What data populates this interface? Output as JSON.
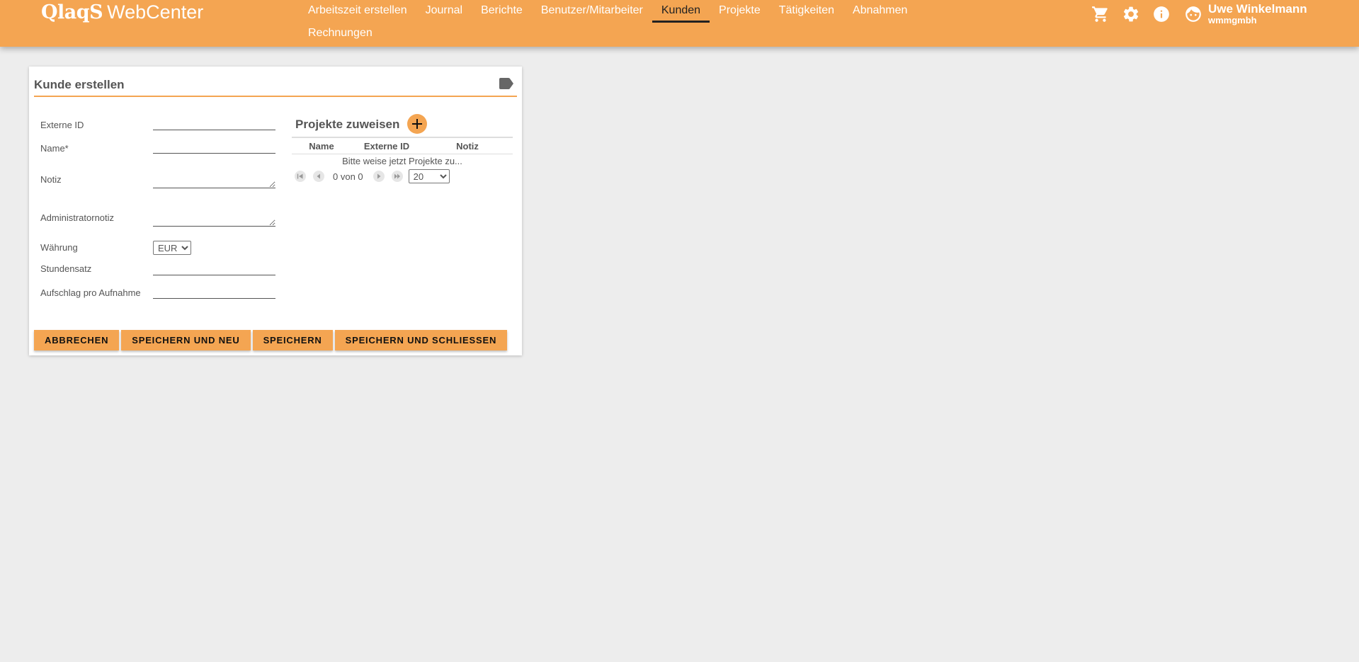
{
  "brand": {
    "logo": "QlaqS",
    "product": "WebCenter"
  },
  "nav": {
    "items": [
      {
        "label": "Arbeitszeit erstellen"
      },
      {
        "label": "Journal"
      },
      {
        "label": "Berichte"
      },
      {
        "label": "Benutzer/Mitarbeiter"
      },
      {
        "label": "Kunden",
        "active": true
      },
      {
        "label": "Projekte"
      },
      {
        "label": "Tätigkeiten"
      },
      {
        "label": "Abnahmen"
      },
      {
        "label": "Rechnungen"
      }
    ]
  },
  "header_icons": [
    "cart-icon",
    "gear-icon",
    "info-icon"
  ],
  "user": {
    "name": "Uwe Winkelmann",
    "org": "wmmgmbh",
    "avatar_icon": "face-icon"
  },
  "card": {
    "title": "Kunde erstellen",
    "tag_icon": "label-icon"
  },
  "form": {
    "external_id_label": "Externe ID",
    "external_id_value": "",
    "name_label": "Name*",
    "name_value": "",
    "note_label": "Notiz",
    "note_value": "",
    "admin_note_label": "Administratornotiz",
    "admin_note_value": "",
    "currency_label": "Währung",
    "currency_value": "EUR",
    "hourly_rate_label": "Stundensatz",
    "hourly_rate_value": "",
    "surcharge_label": "Aufschlag pro Aufnahme",
    "surcharge_value": ""
  },
  "projects": {
    "title": "Projekte zuweisen",
    "add_icon": "plus-icon",
    "columns": [
      "Name",
      "Externe ID",
      "Notiz"
    ],
    "empty_text": "Bitte weise jetzt Projekte zu...",
    "pager": {
      "range_text": "0 von 0",
      "page_size": "20"
    }
  },
  "actions": {
    "cancel": "ABBRECHEN",
    "save_new": "SPEICHERN UND NEU",
    "save": "SPEICHERN",
    "save_close": "SPEICHERN UND SCHLIESSEN"
  },
  "colors": {
    "accent": "#f4a552",
    "background": "#ededed",
    "text": "#555555"
  }
}
